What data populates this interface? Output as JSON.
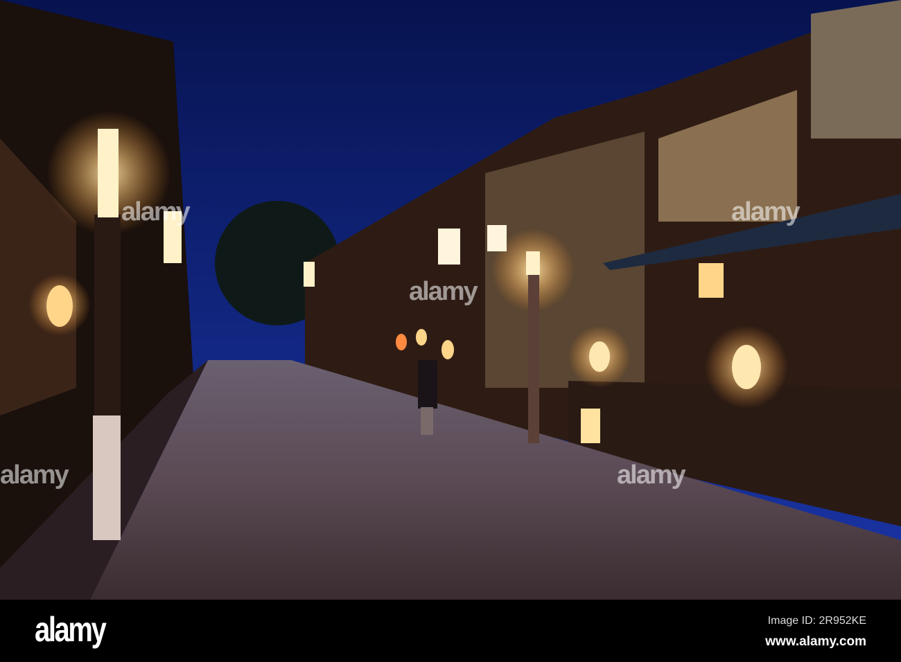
{
  "photo": {
    "subject": "Hanamikoji street at dusk",
    "colors": {
      "sky": "#0b1a6e",
      "lamp": "#ffd58a",
      "pavement": "#5a4a52",
      "wood": "#3a2418"
    }
  },
  "watermark": {
    "text": "alamy"
  },
  "footer": {
    "logo": "alamy",
    "image_id": "Image ID: 2R952KE",
    "url": "www.alamy.com"
  }
}
